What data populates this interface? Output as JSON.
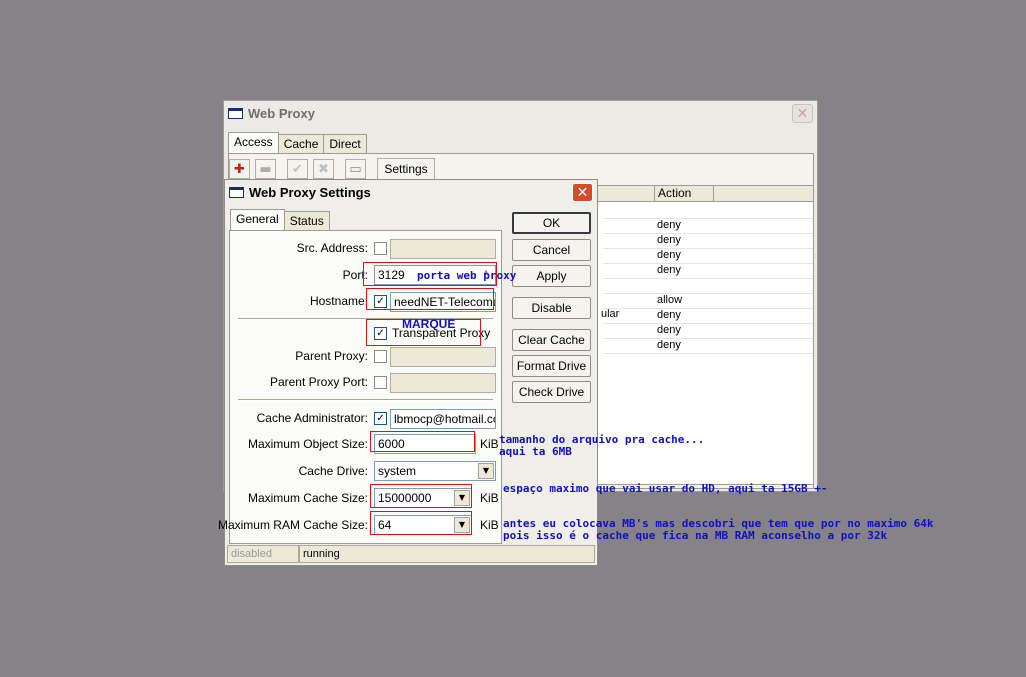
{
  "web_proxy": {
    "title": "Web Proxy",
    "tabs": [
      "Access",
      "Cache",
      "Direct"
    ],
    "toolbar": {
      "settings_label": "Settings"
    },
    "list": {
      "action_header": "Action",
      "actions": [
        "deny",
        "deny",
        "deny",
        "deny",
        "allow",
        "deny",
        "deny",
        "deny"
      ],
      "fragment": "ular"
    }
  },
  "settings": {
    "title": "Web Proxy Settings",
    "tabs": [
      "General",
      "Status"
    ],
    "labels": {
      "src_address": "Src. Address:",
      "port": "Port:",
      "hostname": "Hostname:",
      "transparent_proxy": "Transparent Proxy",
      "parent_proxy": "Parent Proxy:",
      "parent_proxy_port": "Parent Proxy Port:",
      "cache_admin": "Cache Administrator:",
      "max_object_size": "Maximum Object Size:",
      "cache_drive": "Cache Drive:",
      "max_cache_size": "Maximum Cache Size:",
      "max_ram_cache_size": "Maximum RAM Cache Size:"
    },
    "values": {
      "port": "3129",
      "hostname": "needNET-Telecomun",
      "cache_admin": "lbmocp@hotmail.com",
      "max_object_size": "6000",
      "cache_drive": "system",
      "max_cache_size": "15000000",
      "max_ram_cache_size": "64"
    },
    "checked": {
      "hostname": true,
      "transparent_proxy": true,
      "cache_admin": true,
      "src_address": false,
      "parent_proxy": false,
      "parent_proxy_port": false
    },
    "units": {
      "kib": "KiB"
    },
    "buttons": [
      "OK",
      "Cancel",
      "Apply",
      "Disable",
      "Clear Cache",
      "Format Drive",
      "Check Drive"
    ],
    "status": {
      "left": "disabled",
      "right": "running"
    }
  },
  "annotations": {
    "port": "porta web proxy",
    "transparent": "MARQUE",
    "object_size_1": "tamanho do arquivo pra cache...",
    "object_size_2": "aqui ta 6MB",
    "cache_size": "espaço maximo que vai usar do HD, aqui ta 15GB +-",
    "ram_1": "antes eu colocava MB's mas descobri que tem que por no maximo 64k",
    "ram_2": "pois isso é o cache que fica na MB RAM aconselho a por 32k"
  },
  "colors": {
    "annotation": "#1010c0",
    "highlight": "#e01010",
    "close_active": "#d44b2a"
  }
}
